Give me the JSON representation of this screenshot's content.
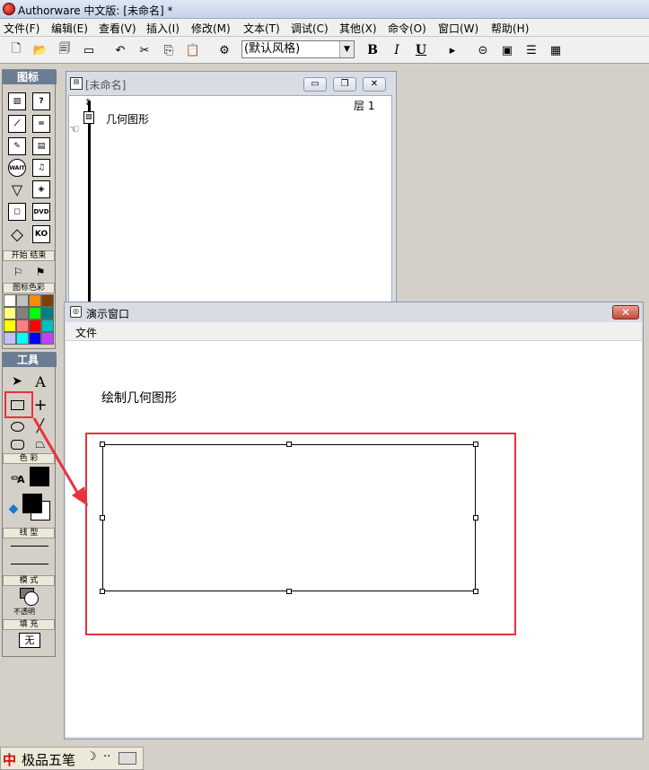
{
  "window": {
    "title": "Authorware 中文版: [未命名] *"
  },
  "menu": [
    "文件(F)",
    "编辑(E)",
    "查看(V)",
    "插入(I)",
    "修改(M)",
    "文本(T)",
    "调试(C)",
    "其他(X)",
    "命令(O)",
    "窗口(W)",
    "帮助(H)"
  ],
  "toolbar": {
    "style_value": "(默认风格)",
    "bold": "B",
    "italic": "I",
    "underline": "U"
  },
  "icon_palette": {
    "title": "图标",
    "start_end_label": "开始 结束",
    "colors_label": "图标色彩",
    "icon_labels": {
      "wait": "WAIT",
      "dvd": "DVD",
      "ko": "KO"
    },
    "swatches": [
      "#ffffff",
      "#c0c0c0",
      "#ff8c00",
      "#804000",
      "#ffff80",
      "#808080",
      "#00ff00",
      "#008080",
      "#ffff00",
      "#ff8080",
      "#ff0000",
      "#00c0c0",
      "#c0c0ff",
      "#00ffff",
      "#0000ff",
      "#c040ff"
    ]
  },
  "tools_palette": {
    "title": "工具",
    "color_label": "色 彩",
    "line_label": "线 型",
    "mode_label": "模 式",
    "mode_value": "不透明",
    "fill_label": "填 充",
    "fill_value": "无",
    "text_tool_glyph": "A",
    "text_color_glyph": "A"
  },
  "flow_window": {
    "title": "[未命名]",
    "layer": "层 1",
    "icon_name": "几何图形"
  },
  "presentation_window": {
    "title": "演示窗口",
    "menu_file": "文件",
    "canvas_text": "绘制几何图形"
  },
  "taskbar": {
    "ime": "极品五笔"
  }
}
